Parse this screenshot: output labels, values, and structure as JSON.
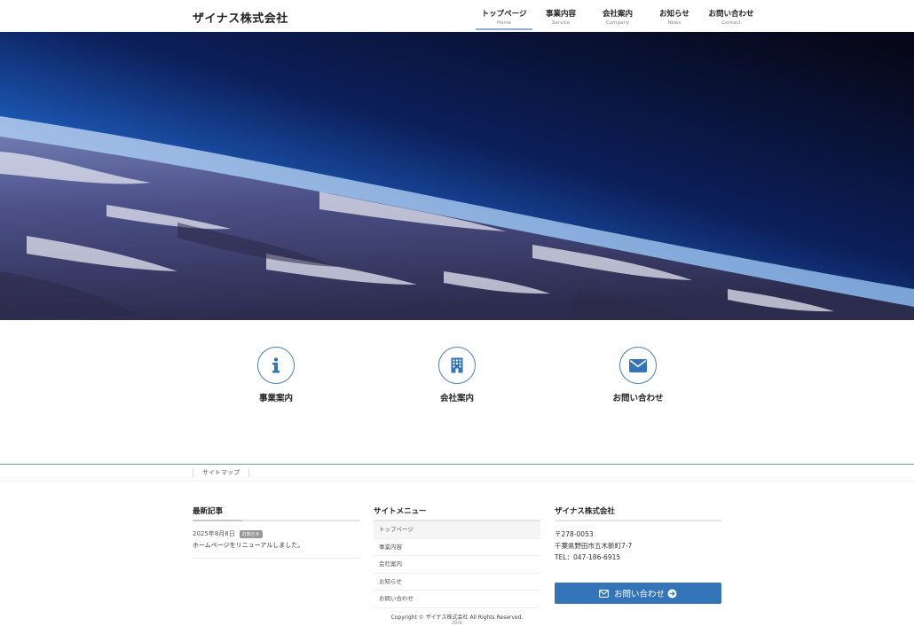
{
  "site": {
    "title": "ザイナス株式会社"
  },
  "nav": [
    {
      "ja": "トップページ",
      "en": "Home",
      "active": true
    },
    {
      "ja": "事業内容",
      "en": "Service"
    },
    {
      "ja": "会社案内",
      "en": "Company"
    },
    {
      "ja": "お知らせ",
      "en": "News"
    },
    {
      "ja": "お問い合わせ",
      "en": "Contact"
    }
  ],
  "features": [
    {
      "label": "事業案内",
      "icon": "info-icon"
    },
    {
      "label": "会社案内",
      "icon": "building-icon"
    },
    {
      "label": "お問い合わせ",
      "icon": "envelope-icon"
    }
  ],
  "sitemap": {
    "label": "サイトマップ"
  },
  "footer": {
    "recent": {
      "title": "最新記事",
      "posts": [
        {
          "date": "2025年8月8日",
          "badge": "お知らせ",
          "title": "ホームページをリニューアルしました。"
        }
      ]
    },
    "menu": {
      "title": "サイトメニュー",
      "items": [
        "トップページ",
        "事業内容",
        "会社案内",
        "お知らせ",
        "お問い合わせ"
      ]
    },
    "company": {
      "title": "ザイナス株式会社",
      "postal": "〒278-0053",
      "address": "千葉県野田市五木新町7-7",
      "tel": "TEL：047-186-6915"
    },
    "contact_button": "お問い合わせ",
    "copyright": "Copyright © ザイナス株式会社 All Rights Reserved.",
    "powered": "ZIUS"
  },
  "colors": {
    "accent": "#3474b8",
    "icon_border": "#4a7fbf",
    "rule": "#6a9ea0"
  }
}
